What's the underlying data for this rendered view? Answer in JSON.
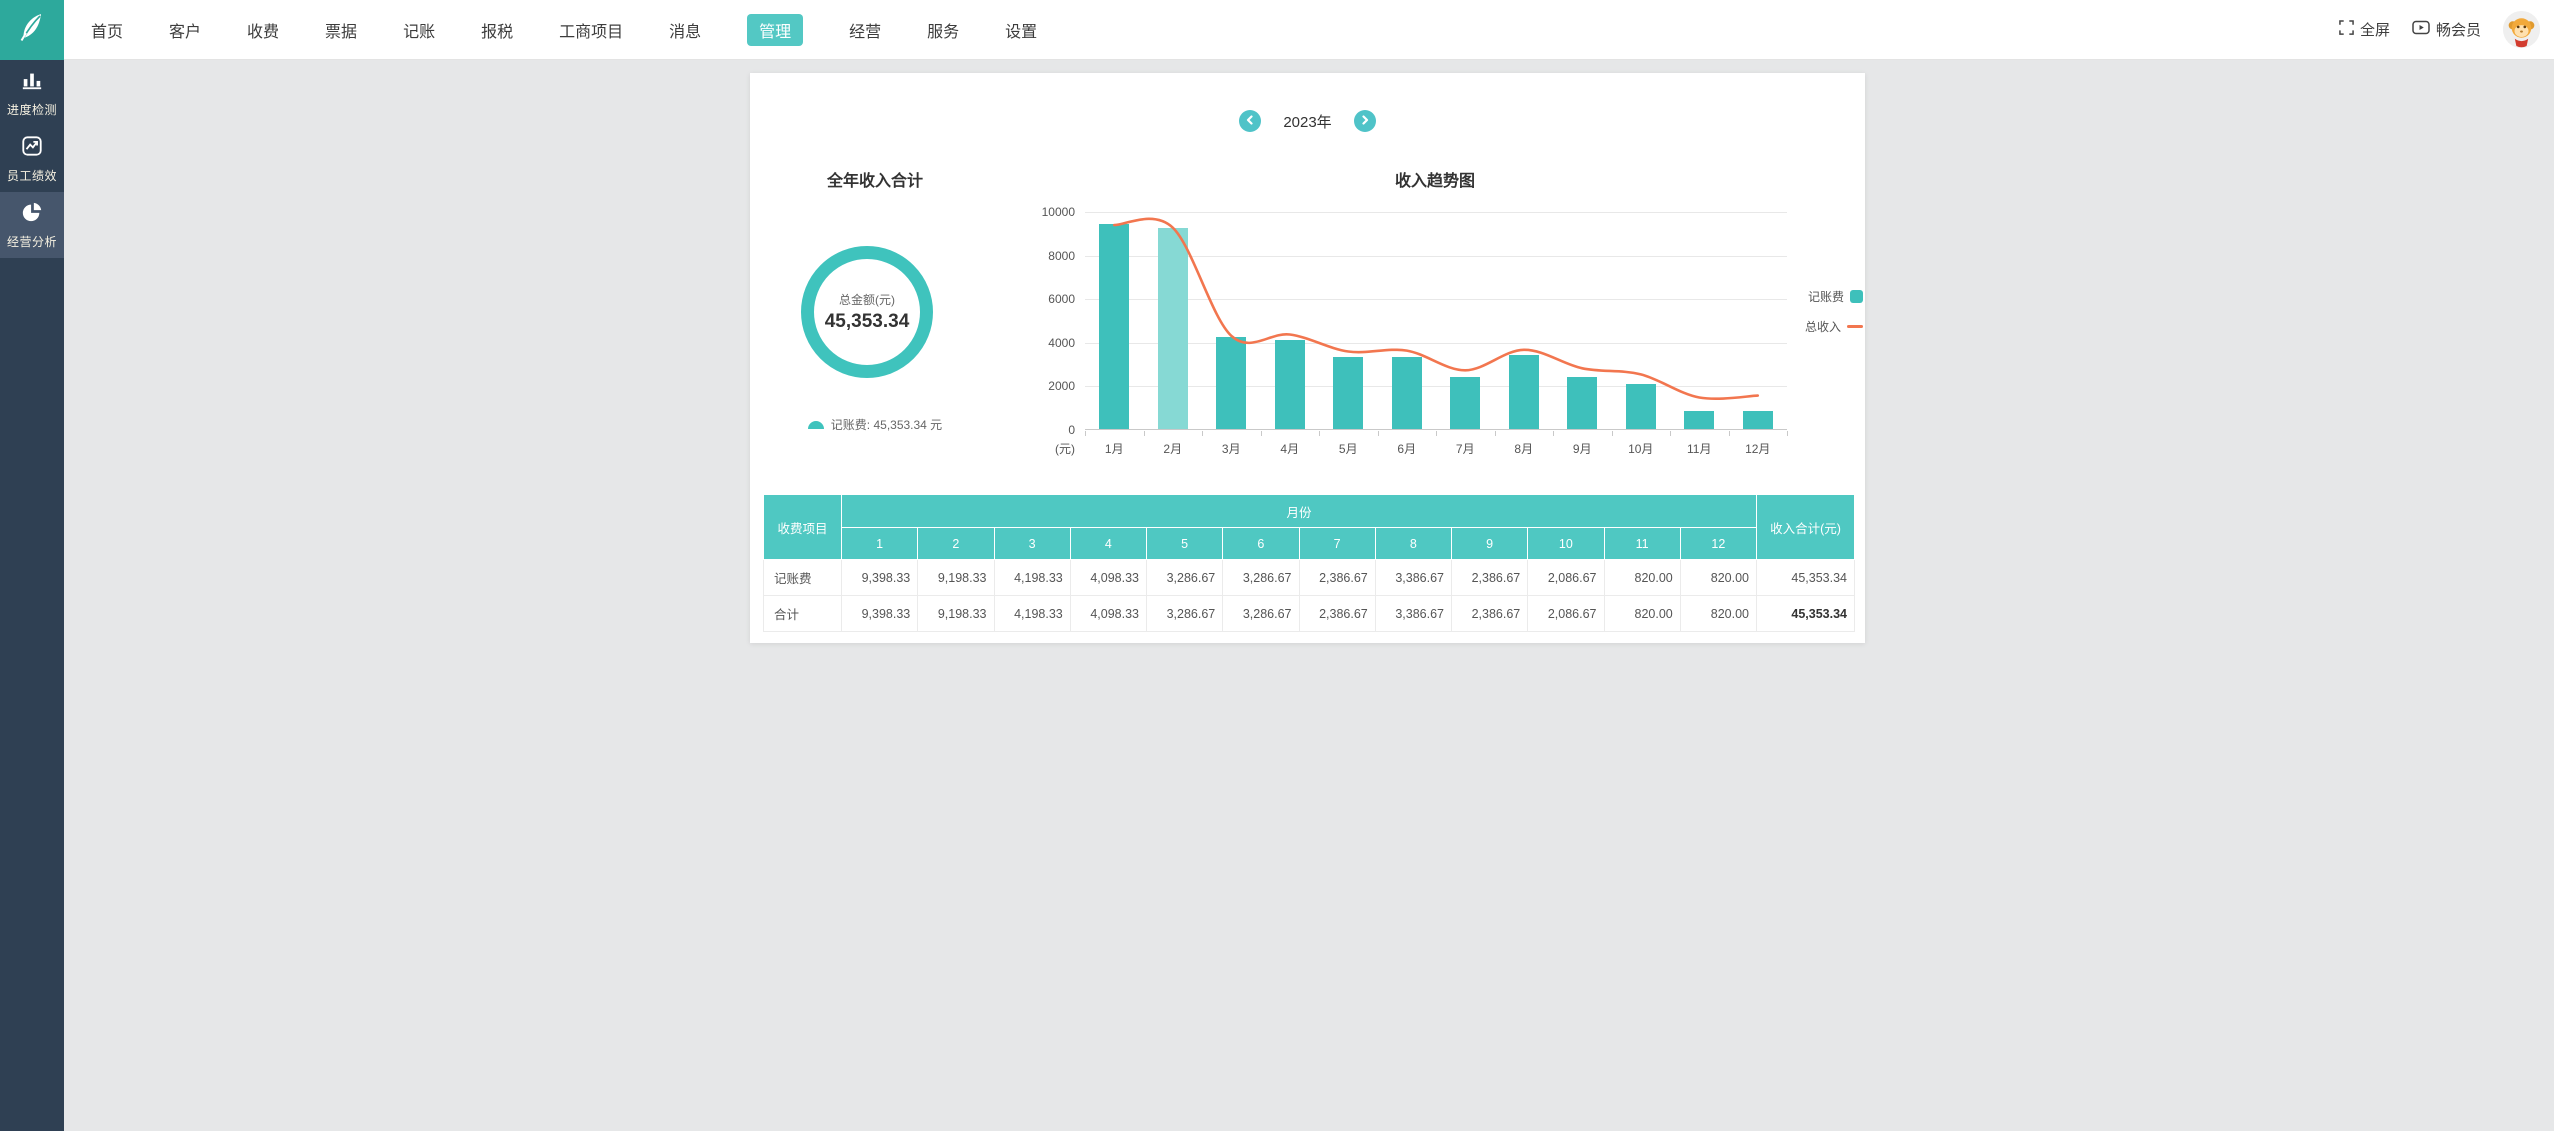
{
  "topbar": {
    "menu": [
      "首页",
      "客户",
      "收费",
      "票据",
      "记账",
      "报税",
      "工商项目",
      "消息",
      "管理",
      "经营",
      "服务",
      "设置"
    ],
    "active_item": "管理",
    "fullscreen_label": "全屏",
    "member_label": "畅会员"
  },
  "sidebar": {
    "items": [
      {
        "label": "进度检测",
        "icon": "bar-chart-icon",
        "active": false
      },
      {
        "label": "员工绩效",
        "icon": "line-chart-icon",
        "active": false
      },
      {
        "label": "经营分析",
        "icon": "pie-chart-icon",
        "active": true
      }
    ]
  },
  "panel": {
    "year": "2023年",
    "summary": {
      "title": "全年收入合计",
      "center_label": "总金额(元)",
      "center_value": "45,353.34",
      "legend_text": "记账费:  45,353.34 元"
    },
    "trend": {
      "title": "收入趋势图"
    }
  },
  "chart_data": {
    "type": "bar+line",
    "title": "收入趋势图",
    "categories": [
      "1月",
      "2月",
      "3月",
      "4月",
      "5月",
      "6月",
      "7月",
      "8月",
      "9月",
      "10月",
      "11月",
      "12月"
    ],
    "series": [
      {
        "name": "记账费",
        "type": "bar",
        "values": [
          9398.33,
          9198.33,
          4198.33,
          4098.33,
          3286.67,
          3286.67,
          2386.67,
          3386.67,
          2386.67,
          2086.67,
          820.0,
          820.0
        ]
      },
      {
        "name": "总收入",
        "type": "line",
        "smooth": true,
        "values": [
          9400,
          9280,
          4320,
          4380,
          3600,
          3640,
          2740,
          3680,
          2830,
          2550,
          1490,
          1580
        ]
      }
    ],
    "ylim": [
      0,
      10000
    ],
    "yticks": [
      0,
      2000,
      4000,
      6000,
      8000,
      10000
    ],
    "y_unit_label": "(元)",
    "legend_position": "right",
    "grid": true,
    "highlighted_bar_index": 1,
    "annual_total": 45353.34
  },
  "table": {
    "first_col_header": "收费项目",
    "month_group_header": "月份",
    "month_headers": [
      "1",
      "2",
      "3",
      "4",
      "5",
      "6",
      "7",
      "8",
      "9",
      "10",
      "11",
      "12"
    ],
    "total_header": "收入合计(元)",
    "rows": [
      {
        "label": "记账费",
        "values": [
          "9,398.33",
          "9,198.33",
          "4,198.33",
          "4,098.33",
          "3,286.67",
          "3,286.67",
          "2,386.67",
          "3,386.67",
          "2,386.67",
          "2,086.67",
          "820.00",
          "820.00"
        ],
        "total": "45,353.34",
        "total_bold": false
      },
      {
        "label": "合计",
        "values": [
          "9,398.33",
          "9,198.33",
          "4,198.33",
          "4,098.33",
          "3,286.67",
          "3,286.67",
          "2,386.67",
          "3,386.67",
          "2,386.67",
          "2,086.67",
          "820.00",
          "820.00"
        ],
        "total": "45,353.34",
        "total_bold": true
      }
    ]
  },
  "colors": {
    "bar": "#3ec0bb",
    "bar_highlight": "#86d9d4",
    "line": "#f2764f",
    "donut_ring": "#3fc3bd",
    "table_header": "#4fc8c2",
    "nav_active": "#53c8c4",
    "logo_bg": "#2da99c",
    "sidebar_bg": "#2f4053",
    "sidebar_active": "#46566c",
    "page_bg": "#e6e7e8"
  }
}
